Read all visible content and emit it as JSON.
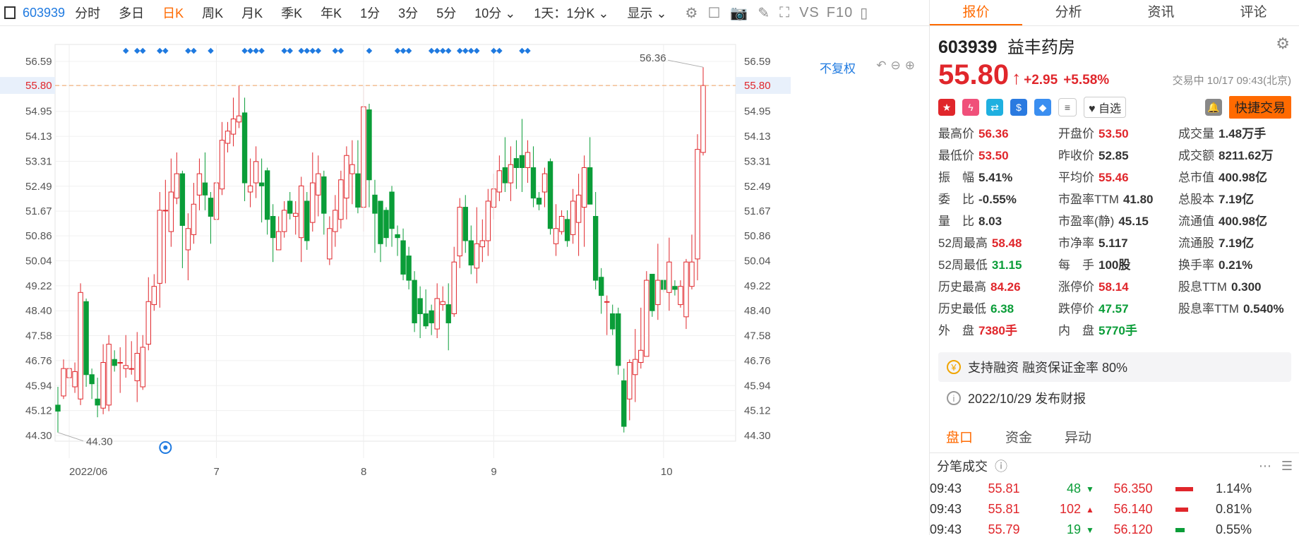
{
  "toolbar": {
    "code": "603939",
    "items": [
      "分时",
      "多日",
      "日K",
      "周K",
      "月K",
      "季K",
      "年K",
      "1分",
      "3分",
      "5分",
      "10分 ⌄",
      "1天：1分K ⌄",
      "显示 ⌄"
    ],
    "active": "日K",
    "tool_icons": [
      "gear-icon",
      "square-icon",
      "camera-icon",
      "pen-icon",
      "fullscreen-icon",
      "vs-icon",
      "f10-icon",
      "panel-icon"
    ],
    "vs_label": "VS",
    "f10_label": "F10"
  },
  "chart": {
    "fq_label": "不复权",
    "y_ticks": [
      "56.59",
      "55.80",
      "54.95",
      "54.13",
      "53.31",
      "52.49",
      "51.67",
      "50.86",
      "50.04",
      "49.22",
      "48.40",
      "47.58",
      "46.76",
      "45.94",
      "45.12",
      "44.30"
    ],
    "x_labels": [
      "2022/06",
      "7",
      "8",
      "9",
      "10"
    ],
    "current_price_label": "55.80",
    "high_label": "56.36",
    "low_label": "44.30"
  },
  "chart_data": {
    "type": "candlestick",
    "ylim": [
      44.3,
      56.59
    ],
    "up_color": "#e0262b",
    "down_color": "#0a9d38",
    "candles": [
      [
        45.3,
        45.1,
        45.9,
        44.4
      ],
      [
        45.6,
        46.5,
        46.8,
        45.5
      ],
      [
        46.2,
        46.5,
        46.8,
        45.9
      ],
      [
        45.9,
        46.4,
        46.7,
        45.7
      ],
      [
        45.5,
        49.0,
        49.3,
        45.3
      ],
      [
        48.7,
        46.3,
        48.8,
        45.9
      ],
      [
        46.3,
        46.0,
        46.5,
        45.5
      ],
      [
        45.5,
        45.3,
        46.2,
        44.9
      ],
      [
        45.2,
        46.7,
        47.3,
        45.0
      ],
      [
        45.3,
        47.3,
        47.6,
        45.1
      ],
      [
        46.8,
        46.6,
        47.1,
        46.4
      ],
      [
        46.7,
        46.7,
        47.2,
        45.7
      ],
      [
        46.5,
        46.6,
        47.6,
        46.2
      ],
      [
        46.5,
        46.5,
        47.4,
        46.3
      ],
      [
        46.1,
        47.0,
        47.7,
        45.4
      ],
      [
        45.9,
        47.2,
        47.6,
        45.8
      ],
      [
        47.3,
        48.7,
        49.5,
        47.1
      ],
      [
        48.6,
        49.2,
        49.6,
        48.4
      ],
      [
        49.3,
        51.7,
        52.3,
        48.5
      ],
      [
        51.7,
        51.7,
        52.7,
        49.3
      ],
      [
        51.0,
        52.3,
        53.4,
        50.5
      ],
      [
        52.1,
        52.9,
        53.6,
        51.9
      ],
      [
        52.9,
        51.2,
        53.0,
        49.8
      ],
      [
        50.4,
        51.1,
        51.6,
        49.4
      ],
      [
        50.9,
        51.9,
        52.6,
        50.6
      ],
      [
        52.2,
        52.9,
        53.4,
        51.7
      ],
      [
        52.6,
        52.2,
        53.6,
        51.7
      ],
      [
        52.1,
        51.5,
        52.3,
        50.6
      ],
      [
        51.4,
        52.6,
        53.6,
        51.2
      ],
      [
        52.4,
        54.0,
        54.6,
        52.2
      ],
      [
        53.9,
        54.3,
        54.6,
        53.6
      ],
      [
        54.2,
        54.7,
        55.4,
        53.8
      ],
      [
        54.6,
        54.8,
        55.8,
        54.4
      ],
      [
        54.9,
        52.6,
        55.4,
        52.0
      ],
      [
        52.3,
        52.5,
        53.4,
        51.8
      ],
      [
        52.6,
        53.3,
        53.8,
        52.1
      ],
      [
        52.6,
        52.5,
        53.4,
        51.3
      ],
      [
        53.0,
        51.4,
        53.1,
        50.9
      ],
      [
        51.5,
        50.8,
        51.9,
        50.0
      ],
      [
        50.4,
        51.0,
        51.5,
        50.6
      ],
      [
        51.0,
        51.7,
        52.0,
        50.8
      ],
      [
        52.0,
        51.6,
        52.3,
        51.4
      ],
      [
        51.5,
        51.6,
        52.0,
        50.9
      ],
      [
        50.8,
        52.5,
        52.8,
        50.0
      ],
      [
        52.0,
        50.7,
        52.3,
        50.4
      ],
      [
        51.3,
        52.6,
        53.6,
        51.0
      ],
      [
        52.2,
        52.9,
        53.5,
        51.5
      ],
      [
        52.8,
        51.6,
        53.0,
        50.9
      ],
      [
        50.1,
        51.1,
        51.5,
        49.9
      ],
      [
        51.0,
        51.7,
        52.2,
        50.5
      ],
      [
        51.4,
        52.7,
        53.0,
        51.1
      ],
      [
        52.1,
        53.5,
        53.8,
        51.4
      ],
      [
        52.9,
        53.2,
        54.0,
        51.9
      ],
      [
        52.9,
        51.8,
        54.0,
        51.6
      ],
      [
        51.8,
        55.1,
        55.8,
        51.0
      ],
      [
        55.0,
        52.7,
        55.2,
        51.8
      ],
      [
        52.2,
        51.6,
        52.7,
        50.3
      ],
      [
        52.0,
        50.6,
        51.5,
        50.0
      ],
      [
        51.7,
        50.8,
        51.8,
        50.5
      ],
      [
        52.3,
        51.1,
        52.5,
        50.5
      ],
      [
        50.9,
        50.8,
        51.2,
        50.2
      ],
      [
        50.7,
        49.6,
        51.1,
        49.4
      ],
      [
        50.2,
        49.4,
        50.5,
        49.1
      ],
      [
        49.4,
        48.0,
        49.7,
        47.7
      ],
      [
        48.8,
        48.3,
        49.2,
        47.5
      ],
      [
        48.3,
        47.9,
        49.1,
        47.8
      ],
      [
        48.4,
        48.0,
        48.6,
        47.6
      ],
      [
        47.8,
        48.8,
        49.3,
        47.5
      ],
      [
        48.6,
        48.7,
        49.2,
        48.4
      ],
      [
        48.6,
        48.0,
        49.3,
        47.1
      ],
      [
        48.3,
        50.0,
        50.5,
        48.2
      ],
      [
        50.2,
        51.8,
        52.1,
        49.8
      ],
      [
        51.8,
        50.7,
        52.2,
        50.3
      ],
      [
        50.7,
        49.9,
        51.2,
        49.6
      ],
      [
        49.8,
        50.6,
        51.8,
        49.3
      ],
      [
        50.5,
        50.7,
        51.4,
        50.0
      ],
      [
        50.7,
        52.0,
        52.4,
        50.2
      ],
      [
        51.8,
        52.4,
        52.9,
        51.4
      ],
      [
        52.3,
        53.0,
        53.5,
        52.0
      ],
      [
        53.1,
        52.6,
        54.1,
        52.3
      ],
      [
        52.6,
        53.2,
        53.8,
        52.0
      ],
      [
        53.4,
        53.1,
        54.0,
        52.4
      ],
      [
        53.5,
        53.1,
        54.7,
        52.3
      ],
      [
        53.1,
        53.6,
        54.0,
        52.6
      ],
      [
        53.1,
        52.1,
        53.8,
        51.8
      ],
      [
        52.1,
        51.9,
        52.3,
        51.7
      ],
      [
        52.3,
        52.9,
        53.1,
        51.8
      ],
      [
        53.3,
        51.1,
        53.4,
        50.9
      ],
      [
        50.6,
        51.1,
        51.9,
        50.2
      ],
      [
        51.0,
        51.5,
        51.7,
        50.9
      ],
      [
        51.4,
        50.7,
        51.7,
        50.5
      ],
      [
        50.9,
        52.0,
        52.4,
        50.6
      ],
      [
        51.3,
        52.2,
        52.9,
        50.2
      ],
      [
        51.8,
        53.1,
        53.5,
        50.5
      ],
      [
        53.1,
        51.9,
        54.1,
        51.9
      ],
      [
        51.5,
        49.4,
        52.3,
        49.1
      ],
      [
        49.5,
        48.9,
        49.8,
        48.3
      ],
      [
        48.7,
        48.7,
        48.9,
        47.6
      ],
      [
        48.3,
        47.8,
        48.6,
        47.6
      ],
      [
        48.3,
        46.6,
        48.5,
        46.3
      ],
      [
        46.1,
        44.6,
        46.5,
        44.4
      ],
      [
        45.5,
        46.7,
        46.8,
        44.8
      ],
      [
        46.3,
        46.8,
        47.8,
        45.4
      ],
      [
        46.7,
        47.1,
        48.5,
        46.5
      ],
      [
        46.9,
        49.4,
        49.7,
        47.3
      ],
      [
        49.6,
        48.4,
        49.6,
        48.2
      ],
      [
        48.6,
        49.4,
        50.6,
        48.1
      ],
      [
        49.4,
        49.1,
        49.3,
        49.0
      ],
      [
        49.0,
        50.0,
        50.8,
        48.4
      ],
      [
        49.2,
        49.1,
        49.4,
        48.9
      ],
      [
        48.6,
        49.2,
        49.4,
        48.5
      ],
      [
        48.2,
        50.0,
        50.1,
        47.8
      ],
      [
        49.2,
        50.0,
        50.9,
        49.1
      ],
      [
        50.1,
        53.7,
        54.2,
        49.4
      ],
      [
        53.6,
        55.8,
        56.4,
        53.5
      ]
    ]
  },
  "panel": {
    "tabs": [
      "报价",
      "分析",
      "资讯",
      "评论"
    ],
    "active_tab": "报价",
    "code": "603939",
    "name": "益丰药房",
    "price": "55.80",
    "change": "+2.95",
    "change_pct": "+5.58%",
    "trade_time": "交易中 10/17 09:43(北京)",
    "watch_label": "自选",
    "quick_label": "快捷交易",
    "stats": [
      {
        "label": "最高价",
        "value": "56.36",
        "color": "red"
      },
      {
        "label": "开盘价",
        "value": "53.50",
        "color": "red"
      },
      {
        "label": "成交量",
        "value": "1.48万手",
        "color": "black"
      },
      {
        "label": "最低价",
        "value": "53.50",
        "color": "red"
      },
      {
        "label": "昨收价",
        "value": "52.85",
        "color": "black"
      },
      {
        "label": "成交额",
        "value": "8211.62万",
        "color": "black"
      },
      {
        "label": "振　幅",
        "value": "5.41%",
        "color": "black"
      },
      {
        "label": "平均价",
        "value": "55.46",
        "color": "red"
      },
      {
        "label": "总市值",
        "value": "400.98亿",
        "color": "black"
      },
      {
        "label": "委　比",
        "value": "-0.55%",
        "color": "black"
      },
      {
        "label": "市盈率TTM",
        "value": "41.80",
        "color": "black"
      },
      {
        "label": "总股本",
        "value": "7.19亿",
        "color": "black"
      },
      {
        "label": "量　比",
        "value": "8.03",
        "color": "black"
      },
      {
        "label": "市盈率(静)",
        "value": "45.15",
        "color": "black"
      },
      {
        "label": "流通值",
        "value": "400.98亿",
        "color": "black"
      },
      {
        "label": "52周最高",
        "value": "58.48",
        "color": "red"
      },
      {
        "label": "市净率",
        "value": "5.117",
        "color": "black"
      },
      {
        "label": "流通股",
        "value": "7.19亿",
        "color": "black"
      },
      {
        "label": "52周最低",
        "value": "31.15",
        "color": "green"
      },
      {
        "label": "每　手",
        "value": "100股",
        "color": "black"
      },
      {
        "label": "换手率",
        "value": "0.21%",
        "color": "black"
      },
      {
        "label": "历史最高",
        "value": "84.26",
        "color": "red"
      },
      {
        "label": "涨停价",
        "value": "58.14",
        "color": "red"
      },
      {
        "label": "股息TTM",
        "value": "0.300",
        "color": "black"
      },
      {
        "label": "历史最低",
        "value": "6.38",
        "color": "green"
      },
      {
        "label": "跌停价",
        "value": "47.57",
        "color": "green"
      },
      {
        "label": "股息率TTM",
        "value": "0.540%",
        "color": "black"
      },
      {
        "label": "外　盘",
        "value": "7380手",
        "color": "red"
      },
      {
        "label": "内　盘",
        "value": "5770手",
        "color": "green"
      },
      {
        "label": "",
        "value": "",
        "color": "black"
      }
    ],
    "margin_info": "支持融资 融资保证金率 80%",
    "report_info": "2022/10/29  发布财报",
    "subtabs": [
      "盘口",
      "资金",
      "异动"
    ],
    "active_subtab": "盘口",
    "ticks_title": "分笔成交",
    "ticks": [
      {
        "time": "09:43",
        "price": "55.81",
        "vol": "48",
        "dir": "down",
        "p2": "56.350",
        "pct": "1.14%",
        "bar": 0.9
      },
      {
        "time": "09:43",
        "price": "55.81",
        "vol": "102",
        "dir": "up",
        "p2": "56.140",
        "pct": "0.81%",
        "bar": 0.64
      },
      {
        "time": "09:43",
        "price": "55.79",
        "vol": "19",
        "dir": "down",
        "p2": "56.120",
        "pct": "0.55%",
        "bar": 0.45
      }
    ]
  }
}
